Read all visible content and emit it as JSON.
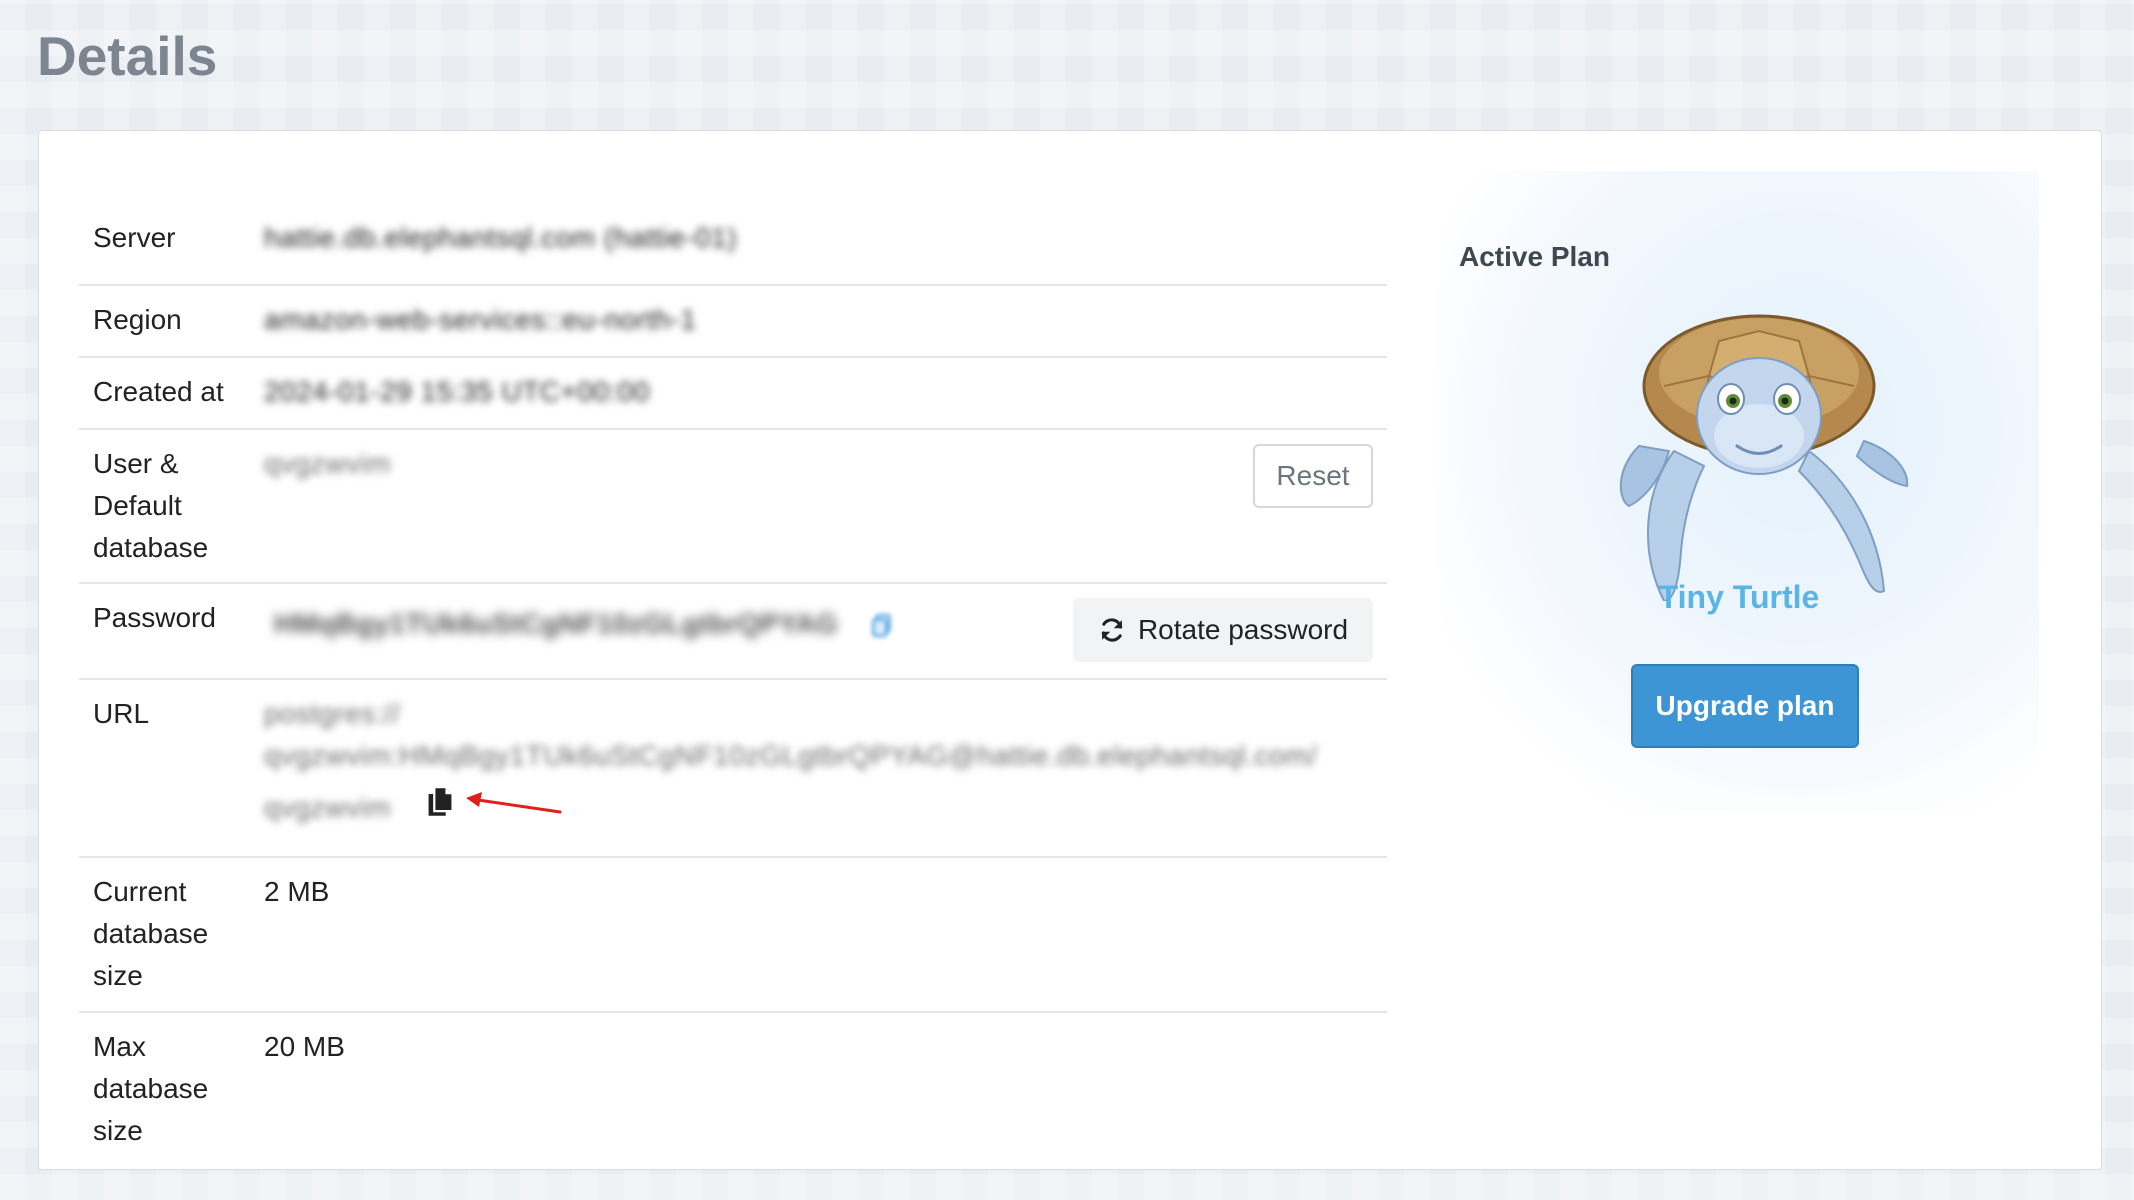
{
  "page": {
    "title": "Details"
  },
  "details": {
    "server": {
      "label": "Server",
      "value": "hattie.db.elephantsql.com (hattie-01)"
    },
    "region": {
      "label": "Region",
      "value": "amazon-web-services::eu-north-1"
    },
    "created": {
      "label": "Created at",
      "value": "2024-01-29 15:35 UTC+00:00"
    },
    "user": {
      "label_line1": "User &",
      "label_line2": "Default",
      "label_line3": "database",
      "value": "qvgzwvim",
      "reset_label": "Reset"
    },
    "password": {
      "label": "Password",
      "value": "HMqBgy1TUk6uStCgNF10zGLgtbrQPYAG",
      "rotate_label": "Rotate password"
    },
    "url": {
      "label": "URL",
      "line1": "postgres://",
      "line2": "qvgzwvim:HMqBgy1TUk6uStCgNF10zGLgtbrQPYAG@hattie.db.elephantsql.com/",
      "line3": "qvgzwvim"
    },
    "current_size": {
      "label_line1": "Current",
      "label_line2": "database",
      "label_line3": "size",
      "value": "2 MB"
    },
    "max_size": {
      "label_line1": "Max",
      "label_line2": "database",
      "label_line3": "size",
      "value": "20 MB"
    }
  },
  "plan": {
    "heading": "Active Plan",
    "name": "Tiny Turtle",
    "upgrade_label": "Upgrade plan"
  },
  "icons": {
    "rotate": "refresh-icon",
    "copy": "copy-icon",
    "annotation": "red-arrow-icon"
  },
  "colors": {
    "plan_name": "#5bb4e6",
    "upgrade_button": "#3d95d6",
    "annotation_arrow": "#e0201c"
  }
}
